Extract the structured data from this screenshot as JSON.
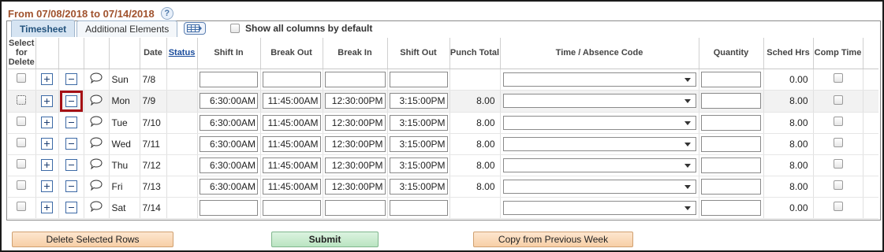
{
  "header": {
    "date_range": "From 07/08/2018 to 07/14/2018",
    "help_icon": "help-icon"
  },
  "tabs": [
    {
      "label": "Timesheet",
      "active": true
    },
    {
      "label": "Additional Elements",
      "active": false
    }
  ],
  "show_all_label": "Show all columns by default",
  "columns": {
    "select": "Select for Delete",
    "date": "Date",
    "status": "Status",
    "shift_in": "Shift In",
    "break_out": "Break Out",
    "break_in": "Break In",
    "shift_out": "Shift Out",
    "punch_total": "Punch Total",
    "time_code": "Time / Absence Code",
    "quantity": "Quantity",
    "sched_hrs": "Sched Hrs",
    "comp_time": "Comp Time"
  },
  "rows": [
    {
      "day": "Sun",
      "date": "7/8",
      "shift_in": "",
      "break_out": "",
      "break_in": "",
      "shift_out": "",
      "punch_total": "",
      "sched_hrs": "0.00"
    },
    {
      "day": "Mon",
      "date": "7/9",
      "shift_in": "6:30:00AM",
      "break_out": "11:45:00AM",
      "break_in": "12:30:00PM",
      "shift_out": "3:15:00PM",
      "punch_total": "8.00",
      "sched_hrs": "8.00"
    },
    {
      "day": "Tue",
      "date": "7/10",
      "shift_in": "6:30:00AM",
      "break_out": "11:45:00AM",
      "break_in": "12:30:00PM",
      "shift_out": "3:15:00PM",
      "punch_total": "8.00",
      "sched_hrs": "8.00"
    },
    {
      "day": "Wed",
      "date": "7/11",
      "shift_in": "6:30:00AM",
      "break_out": "11:45:00AM",
      "break_in": "12:30:00PM",
      "shift_out": "3:15:00PM",
      "punch_total": "8.00",
      "sched_hrs": "8.00"
    },
    {
      "day": "Thu",
      "date": "7/12",
      "shift_in": "6:30:00AM",
      "break_out": "11:45:00AM",
      "break_in": "12:30:00PM",
      "shift_out": "3:15:00PM",
      "punch_total": "8.00",
      "sched_hrs": "8.00"
    },
    {
      "day": "Fri",
      "date": "7/13",
      "shift_in": "6:30:00AM",
      "break_out": "11:45:00AM",
      "break_in": "12:30:00PM",
      "shift_out": "3:15:00PM",
      "punch_total": "8.00",
      "sched_hrs": "8.00"
    },
    {
      "day": "Sat",
      "date": "7/14",
      "shift_in": "",
      "break_out": "",
      "break_in": "",
      "shift_out": "",
      "punch_total": "",
      "sched_hrs": "0.00"
    }
  ],
  "buttons": {
    "delete": "Delete Selected Rows",
    "submit": "Submit",
    "copy": "Copy from Previous Week"
  },
  "colors": {
    "header_text": "#a0522d",
    "highlight_box": "#a50f14",
    "tab_active": "#24547e"
  }
}
